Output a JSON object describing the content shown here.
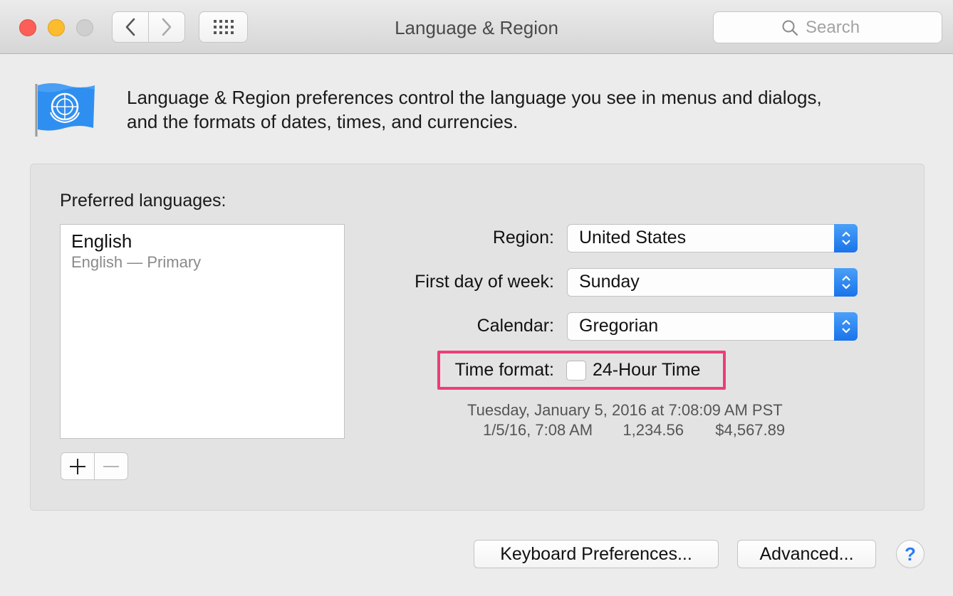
{
  "window": {
    "title": "Language & Region",
    "search_placeholder": "Search"
  },
  "intro": {
    "line1": "Language & Region preferences control the language you see in menus and dialogs,",
    "line2": "and the formats of dates, times, and currencies."
  },
  "languages": {
    "label": "Preferred languages:",
    "items": [
      {
        "name": "English",
        "subtitle": "English — Primary"
      }
    ],
    "add_symbol": "+",
    "remove_symbol": "—"
  },
  "settings": {
    "region": {
      "label": "Region:",
      "value": "United States"
    },
    "first_day": {
      "label": "First day of week:",
      "value": "Sunday"
    },
    "calendar": {
      "label": "Calendar:",
      "value": "Gregorian"
    },
    "time_format": {
      "label": "Time format:",
      "option": "24-Hour Time",
      "checked": false
    }
  },
  "sample": {
    "long_date": "Tuesday, January 5, 2016 at 7:08:09 AM PST",
    "short_date": "1/5/16, 7:08 AM",
    "number": "1,234.56",
    "currency": "$4,567.89"
  },
  "buttons": {
    "keyboard": "Keyboard Preferences...",
    "advanced": "Advanced...",
    "help": "?"
  },
  "colors": {
    "accent": "#1a73ea",
    "highlight": "#ee3d78"
  },
  "icons": [
    "back-chevron-icon",
    "forward-chevron-icon",
    "grid-icon",
    "search-icon",
    "un-flag-icon",
    "stepper-icon",
    "help-icon"
  ]
}
